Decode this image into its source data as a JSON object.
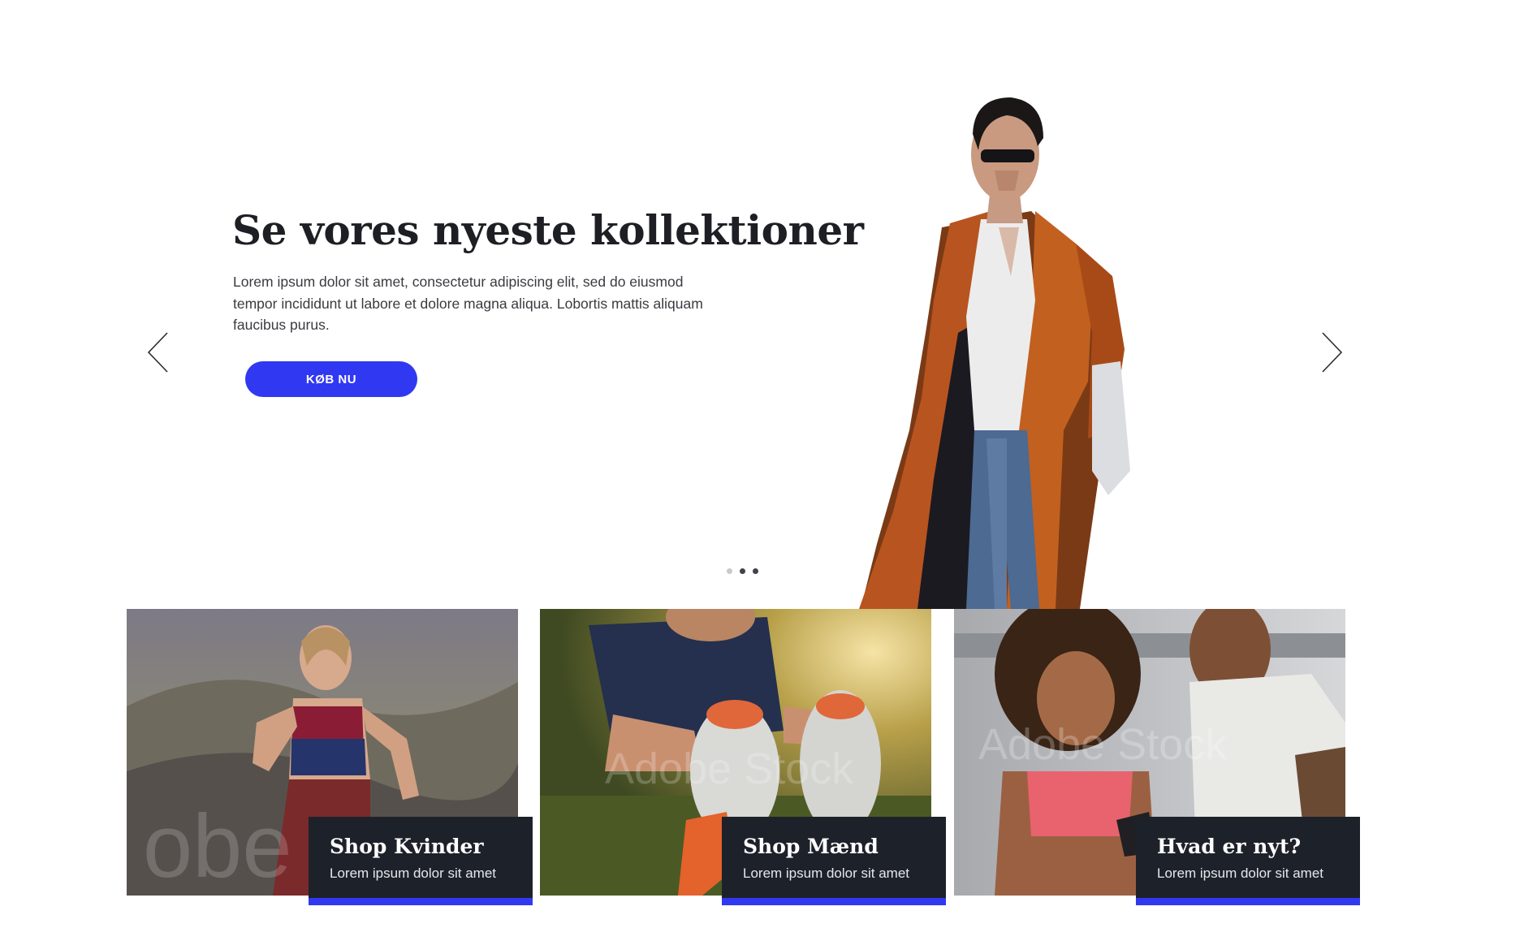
{
  "hero": {
    "title": "Se vores nyeste kollektioner",
    "body": "Lorem ipsum dolor sit amet, consectetur adipiscing elit, sed do eiusmod tempor incididunt ut labore et dolore magna aliqua. Lobortis mattis aliquam faucibus purus.",
    "cta_label": "KØB NU"
  },
  "carousel": {
    "prev_icon": "chevron-left-icon",
    "next_icon": "chevron-right-icon",
    "slide_count": 3
  },
  "cards": [
    {
      "title": "Shop Kvinder",
      "subtitle": "Lorem ipsum dolor sit amet"
    },
    {
      "title": "Shop Mænd",
      "subtitle": "Lorem ipsum dolor sit amet"
    },
    {
      "title": "Hvad er nyt?",
      "subtitle": "Lorem ipsum dolor sit amet"
    }
  ],
  "colors": {
    "accent": "#3138f2",
    "caption_bg": "#1d222a",
    "heading": "#1e1f24"
  }
}
